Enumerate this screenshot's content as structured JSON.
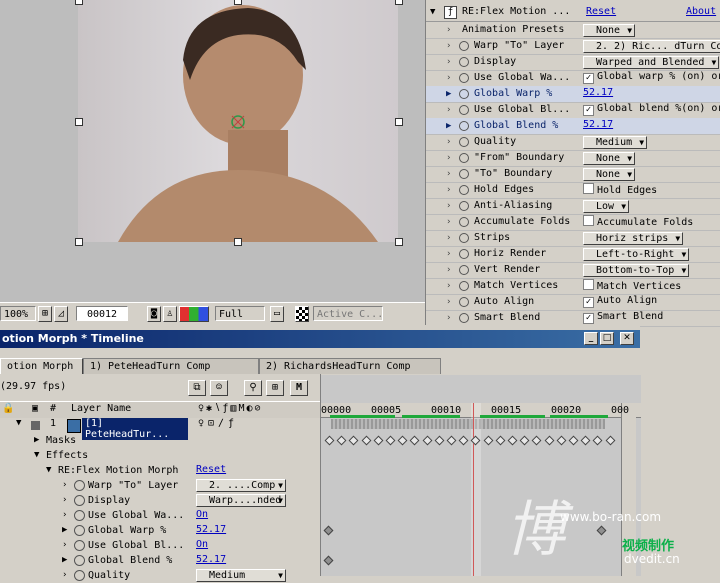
{
  "comp": {
    "zoom": "100%",
    "timecode": "00012",
    "resolution": "Full",
    "camera": "Active C..."
  },
  "effect_controls": {
    "effect_name": "RE:Flex Motion ...",
    "reset_label": "Reset",
    "about_label": "About",
    "rows": [
      {
        "label": "Animation Presets",
        "value": "None",
        "kind": "dropdown"
      },
      {
        "label": "Warp \"To\" Layer",
        "value": "2. 2) Ric... dTurn Com",
        "kind": "dropdown"
      },
      {
        "label": "Display",
        "value": "Warped and Blended",
        "kind": "dropdown"
      },
      {
        "label": "Use Global Wa...",
        "value": "Global warp % (on) or",
        "kind": "checkbox",
        "checked": true
      },
      {
        "label": "Global Warp %",
        "value": "52.17",
        "kind": "number",
        "highlight": true
      },
      {
        "label": "Use Global Bl...",
        "value": "Global blend %(on) or",
        "kind": "checkbox",
        "checked": true
      },
      {
        "label": "Global Blend %",
        "value": "52.17",
        "kind": "number",
        "highlight": true
      },
      {
        "label": "Quality",
        "value": "Medium",
        "kind": "dropdown"
      },
      {
        "label": "\"From\" Boundary",
        "value": "None",
        "kind": "dropdown"
      },
      {
        "label": "\"To\" Boundary",
        "value": "None",
        "kind": "dropdown"
      },
      {
        "label": "Hold Edges",
        "value": "Hold Edges",
        "kind": "checkbox",
        "checked": false
      },
      {
        "label": "Anti-Aliasing",
        "value": "Low",
        "kind": "dropdown"
      },
      {
        "label": "Accumulate Folds",
        "value": "Accumulate Folds",
        "kind": "checkbox",
        "checked": false
      },
      {
        "label": "Strips",
        "value": "Horiz strips",
        "kind": "dropdown"
      },
      {
        "label": "Horiz Render",
        "value": "Left-to-Right",
        "kind": "dropdown"
      },
      {
        "label": "Vert Render",
        "value": "Bottom-to-Top",
        "kind": "dropdown"
      },
      {
        "label": "Match Vertices",
        "value": "Match Vertices",
        "kind": "checkbox",
        "checked": false
      },
      {
        "label": "Auto Align",
        "value": "Auto Align",
        "kind": "checkbox",
        "checked": true
      },
      {
        "label": "Smart Blend",
        "value": "Smart Blend",
        "kind": "checkbox",
        "checked": true
      }
    ]
  },
  "timeline": {
    "title": "otion Morph * Timeline",
    "tabs": [
      "otion Morph",
      "1) PeteHeadTurn Comp",
      "2) RichardsHeadTurn Comp"
    ],
    "fps": "(29.97 fps)",
    "col_num": "#",
    "col_layer": "Layer Name",
    "ruler": [
      "00000",
      "00005",
      "00010",
      "00015",
      "00020",
      "000"
    ],
    "layer": {
      "num": "1",
      "name": "[1] PeteHeadTur..."
    },
    "rows": [
      {
        "label": "Masks",
        "value": ""
      },
      {
        "label": "Effects",
        "value": ""
      },
      {
        "label": "RE:Flex Motion Morph",
        "value": "Reset"
      },
      {
        "label": "Warp \"To\" Layer",
        "value": "2. ....Comp"
      },
      {
        "label": "Display",
        "value": "Warp....nded"
      },
      {
        "label": "Use Global Wa...",
        "value": "On"
      },
      {
        "label": "Global Warp %",
        "value": "52.17"
      },
      {
        "label": "Use Global Bl...",
        "value": "On"
      },
      {
        "label": "Global Blend %",
        "value": "52.17"
      },
      {
        "label": "Quality",
        "value": "Medium"
      }
    ]
  },
  "watermark": {
    "big": "博",
    "url": "www.bo-ran.com",
    "cn": "视频制作",
    "site": "dvedit.cn"
  }
}
